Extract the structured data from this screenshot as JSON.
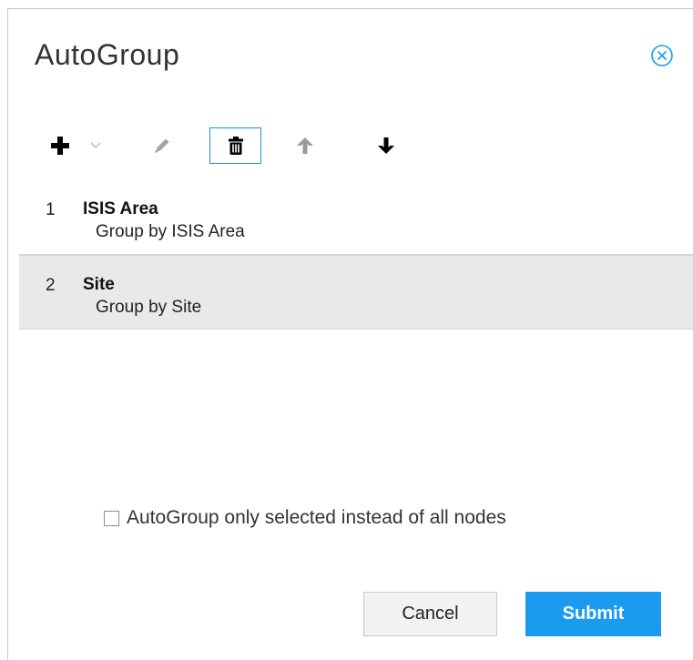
{
  "dialog": {
    "title": "AutoGroup"
  },
  "toolbar": {
    "icons": [
      "plus-icon",
      "chevron-down-icon",
      "pencil-icon",
      "trash-icon",
      "arrow-up-icon",
      "arrow-down-icon"
    ]
  },
  "list": {
    "items": [
      {
        "index": "1",
        "name": "ISIS Area",
        "description": "Group by ISIS Area",
        "selected": false
      },
      {
        "index": "2",
        "name": "Site",
        "description": "Group by Site",
        "selected": true
      }
    ]
  },
  "options": {
    "checkbox_label": "AutoGroup only selected instead of all nodes",
    "checked": false
  },
  "footer": {
    "cancel_label": "Cancel",
    "submit_label": "Submit"
  },
  "colors": {
    "accent": "#1a9bf0",
    "selected_row": "#e9e9e9",
    "focus_border": "#1f8fd7"
  }
}
